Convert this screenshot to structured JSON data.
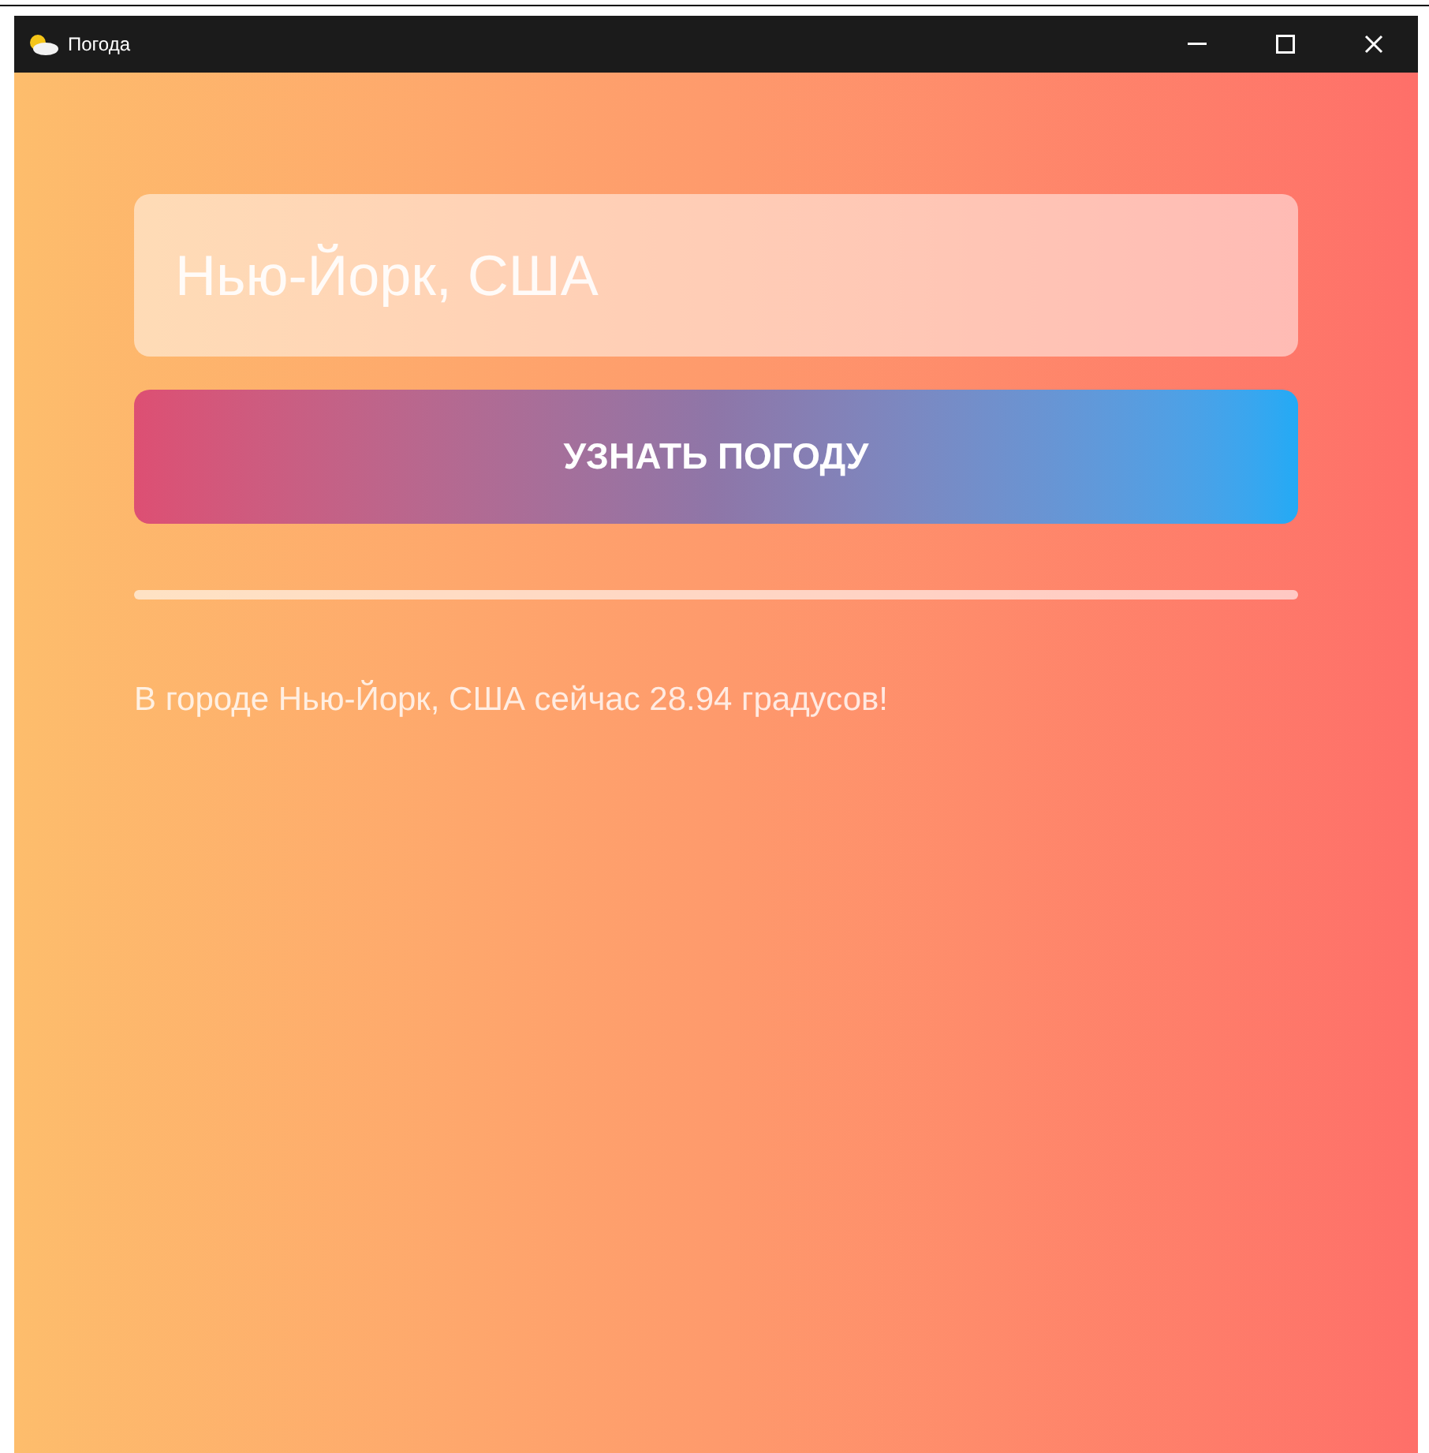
{
  "window": {
    "title": "Погода"
  },
  "city_field": {
    "value": "Нью-Йорк, США"
  },
  "submit_button": {
    "label": "УЗНАТЬ ПОГОДУ"
  },
  "result": {
    "text": "В городе Нью-Йорк, США сейчас 28.94 градусов!"
  }
}
